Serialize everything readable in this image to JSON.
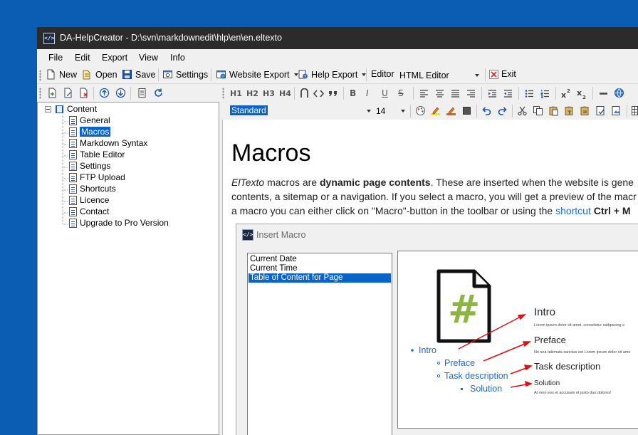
{
  "window": {
    "title": "DA-HelpCreator - D:\\svn\\markdownedit\\hlp\\en\\en.eltexto",
    "app_icon": "code-brackets-icon"
  },
  "menu": [
    "File",
    "Edit",
    "Export",
    "View",
    "Info"
  ],
  "toolbar": {
    "new": "New",
    "open": "Open",
    "save": "Save",
    "settings": "Settings",
    "website_export": "Website Export",
    "help_export": "Help Export",
    "editor_label": "Editor",
    "editor_value": "HTML Editor",
    "exit": "Exit"
  },
  "format_toolbar": {
    "headings": [
      "H1",
      "H2",
      "H3",
      "H4"
    ],
    "bold": "B",
    "italic": "I",
    "underline": "U",
    "strike": "S",
    "style_value": "Standard",
    "size_value": "14"
  },
  "tree": {
    "root": "Content",
    "items": [
      "General",
      "Macros",
      "Markdown Syntax",
      "Table Editor",
      "Settings",
      "FTP Upload",
      "Shortcuts",
      "Licence",
      "Contact",
      "Upgrade to Pro Version"
    ],
    "selected_index": 1
  },
  "document": {
    "heading": "Macros",
    "line1_a": "ElTexto",
    "line1_b": " macros are ",
    "line1_c": "dynamic page contents",
    "line1_d": ". These are inserted when the website is gene",
    "line2": "contents, a sitemap or a navigation. If you select a macro, you will get a preview of the macr",
    "line3_a": "a macro you can either click on \"Macro\"-button in the toolbar or using the ",
    "line3_link": "shortcut",
    "line3_b": " ",
    "line3_c": "Ctrl + M"
  },
  "dialog": {
    "title": "Insert Macro",
    "items": [
      "Current Date",
      "Current Time",
      "Table of Content for Page"
    ],
    "selected_index": 2,
    "preview": {
      "symbol": "#",
      "toc": [
        "Intro",
        "Preface",
        "Task description",
        "Solution"
      ],
      "headings": [
        "Intro",
        "Preface",
        "Task description",
        "Solution"
      ],
      "text1": "Lorem ipsum dolor sit amet, consetetur sadipscing e",
      "text2": "No sea takimata sanctus est Lorem ipsum dolor sit ame",
      "text3": "At vero eos et accusam et justo duo dolores!"
    }
  },
  "colors": {
    "accent": "#0a64c8",
    "link": "#1a6fc8",
    "desktop": "#0a5db3",
    "titlebar": "#2b2b2b",
    "arrow": "#e01010",
    "hash": "#8db544"
  }
}
